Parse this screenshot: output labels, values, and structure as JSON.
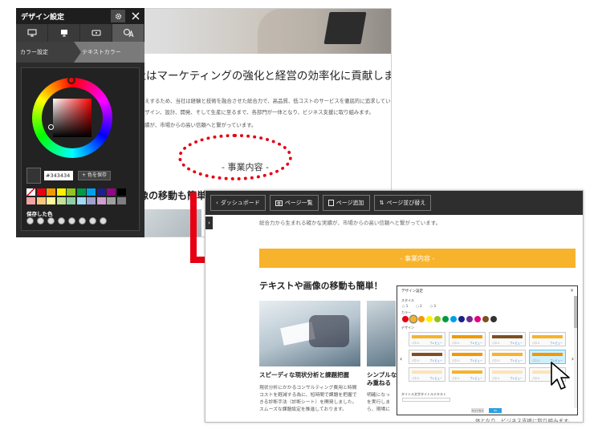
{
  "back_site": {
    "headline": "当社はマーケティングの強化と経営の効率化に貢献します",
    "para1": "にお応えするため、当社は経験と技術を融合させた総合力で、高品質、低コストのサービスを徹底的に追求してい",
    "para2": "画、デザイン、設計、開発、そして生産に至るまで、各部門が一体となり、ビジネス支援に取り組みます。",
    "para3": "かな実績が、市場からの高い信頼へと繋がっています。",
    "section_title": "- 事業内容 -",
    "subhead": "画像の移動も簡単！"
  },
  "panel": {
    "title": "デザイン設定",
    "breadcrumb_1": "カラー設定",
    "breadcrumb_2": "テキストカラー",
    "hex_value": "#343434",
    "add_label": "色を保存",
    "saved_label": "保存した色",
    "palette": [
      "#ffffff",
      "#e60012",
      "#f39800",
      "#fff100",
      "#8fc31f",
      "#009944",
      "#00a0e9",
      "#1d2088",
      "#920783",
      "#000000",
      "#f5a3a3",
      "#f7c77e",
      "#fff799",
      "#c3e09a",
      "#8dcfa3",
      "#9fd9f6",
      "#9ea0cf",
      "#cf9fcf",
      "#a0a0a0",
      "#7f7f7f"
    ]
  },
  "front_site": {
    "toolbar": {
      "dashboard": "ダッシュボード",
      "page_list": "ページ一覧",
      "add_page": "ページ追加",
      "reorder": "ページ並び替え"
    },
    "para": "総合力から生まれる確かな実績が、市場からの高い信頼へと繋がっています。",
    "section_bar": "- 事業内容 -",
    "subhead": "テキストや画像の移動も簡単！",
    "card1_title": "スピーディな現状分析と課題把握",
    "card1_lines": [
      "現状分析にかかるコンサルティング費用と時間",
      "コストを軽減する為に、短時間で課題を把握で",
      "きる診断手法（診断シート）を開発しました。",
      "スムーズな課題設定を推進しております。"
    ],
    "card2_title": "シンプルな",
    "card2_title_2": "み重ねる",
    "card2_lines": [
      "明確になっ",
      "を実行しま",
      "ら、現場に"
    ],
    "bottom_text": "体となり、ビジネス支援に取り組みます。"
  },
  "dialog": {
    "title": "デザイン設定",
    "close": "×",
    "label_style": "スタイル",
    "radio_1": "1",
    "radio_2": "2",
    "radio_3": "3",
    "label_color": "カラー",
    "label_design": "デザイン",
    "colors": [
      "#e60012",
      "#f7b32b",
      "#f39800",
      "#fff100",
      "#8fc31f",
      "#009944",
      "#00a0e9",
      "#1d2088",
      "#6b2d90",
      "#e4007f",
      "#7f4f21",
      "#333333"
    ],
    "tile_name": "パネル",
    "tile_preview": "プレビュー",
    "text_label": "タイトル文字タイトルテキスト",
    "cancel": "キャンセル",
    "ok": "OK",
    "nav_prev": "‹",
    "nav_next": "›",
    "tile_colors": [
      "#f7b32b",
      "#f39800",
      "#7f4f21",
      "#f7b32b",
      "#7f4f21",
      "#f39800",
      "#f7b32b",
      "#f39800",
      "#fce4b8",
      "#f7b32b",
      "#fce4b8",
      "#fce4b8"
    ]
  }
}
